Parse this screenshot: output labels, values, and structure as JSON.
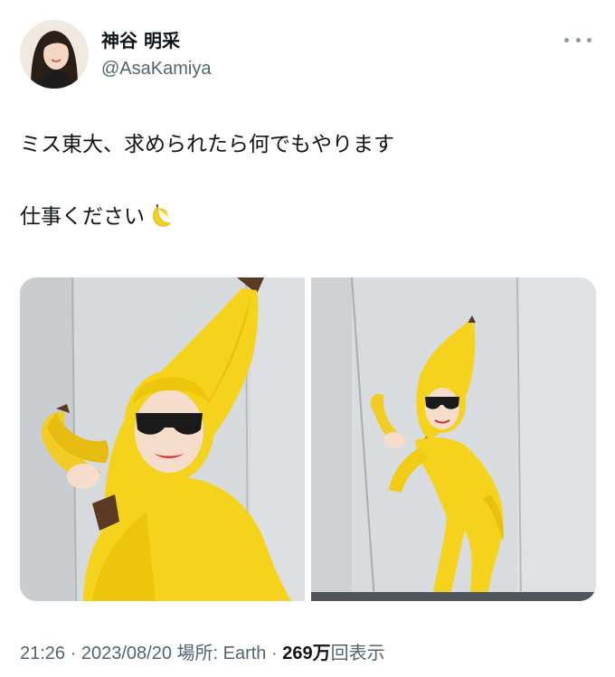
{
  "tweet": {
    "author": {
      "display_name": "神谷 明采",
      "handle": "@AsaKamiya",
      "avatar_icon": "profile-photo"
    },
    "more_icon": "more-horizontal-icon",
    "text_lines": [
      "ミス東大、求められたら何でもやります",
      "仕事ください"
    ],
    "text_emoji": "banana-emoji",
    "media": [
      {
        "kind": "photo",
        "icon": "photo-banana-costume-closeup"
      },
      {
        "kind": "photo",
        "icon": "photo-banana-costume-full-body"
      }
    ],
    "meta": {
      "time": "21:26",
      "sep1": " · ",
      "date": "2023/08/20",
      "location_prefix": " 場所: ",
      "location": "Earth",
      "sep2": " · ",
      "views_count": "269万",
      "views_label": "回表示"
    }
  },
  "colors": {
    "text_primary": "#0f1419",
    "text_secondary": "#536471",
    "costume_yellow": "#f5d21c",
    "banana_tip_brown": "#5a3a22"
  }
}
